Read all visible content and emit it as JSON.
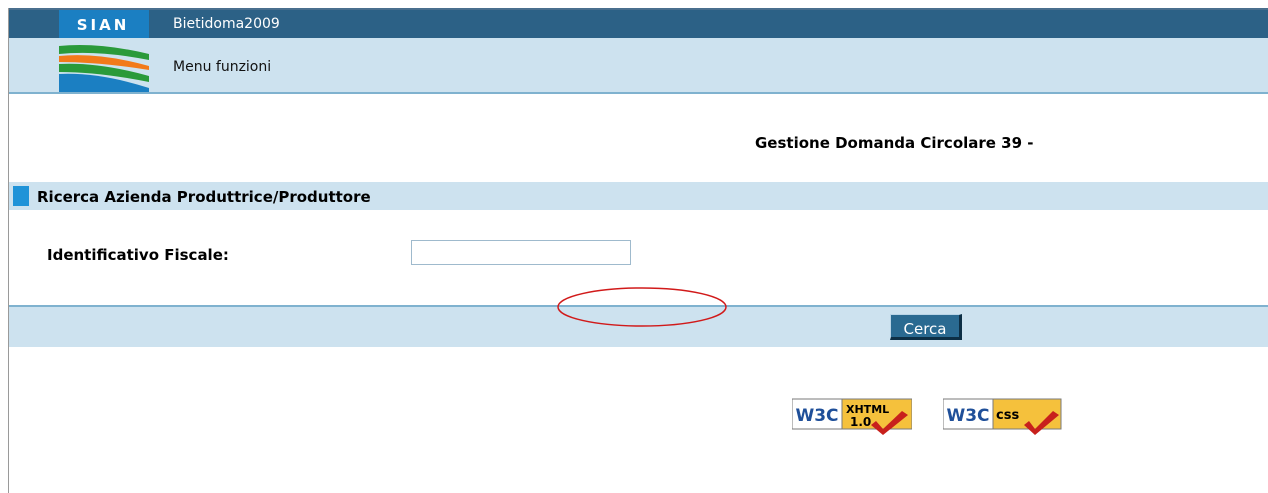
{
  "header": {
    "app_name": "Bietidoma2009",
    "logo_text": "SIAN",
    "menu_label": "Menu funzioni"
  },
  "main": {
    "heading": "Gestione Domanda Circolare 39 -",
    "section_title": "Ricerca Azienda Produttrice/Produttore",
    "field": {
      "label": "Identificativo Fiscale:",
      "value": "",
      "placeholder": ""
    },
    "search_button": "Cerca"
  },
  "badges": {
    "xhtml": {
      "w3c": "W3C",
      "tag": "XHTML",
      "version": "1.0"
    },
    "css": {
      "w3c": "W3C",
      "tag": "css"
    }
  },
  "colors": {
    "title_bar": "#2c6186",
    "light_band": "#cde2ef",
    "section_marker": "#1f93d8",
    "button": "#2a6a91",
    "annotation": "#d11a1a"
  },
  "icons": [
    "sian-logo",
    "check-icon"
  ]
}
